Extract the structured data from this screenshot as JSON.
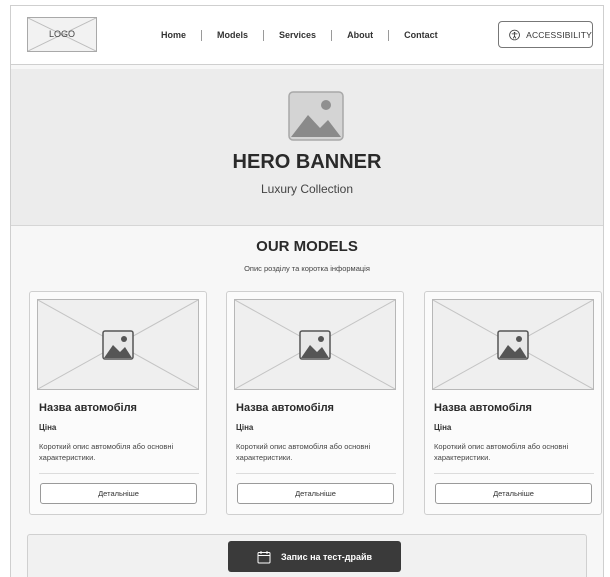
{
  "header": {
    "logo_text": "LOGO",
    "nav": [
      "Home",
      "Models",
      "Services",
      "About",
      "Contact"
    ],
    "accessibility_label": "ACCESSIBILITY"
  },
  "hero": {
    "title": "HERO BANNER",
    "subtitle": "Luxury Collection"
  },
  "models": {
    "title": "OUR MODELS",
    "description": "Опис розділу та коротка інформація",
    "cards": [
      {
        "name": "Назва автомобіля",
        "price": "Ціна",
        "description": "Короткий опис автомобіля або основні характеристики.",
        "button_label": "Детальніше"
      },
      {
        "name": "Назва автомобіля",
        "price": "Ціна",
        "description": "Короткий опис автомобіля або основні характеристики.",
        "button_label": "Детальніше"
      },
      {
        "name": "Назва автомобіля",
        "price": "Ціна",
        "description": "Короткий опис автомобіля або основні характеристики.",
        "button_label": "Детальніше"
      }
    ]
  },
  "cta": {
    "test_drive_label": "Запис на тест-драйв"
  },
  "icons": {
    "accessibility": "accessibility-icon",
    "image_placeholder": "image-placeholder-icon",
    "calendar": "calendar-icon"
  },
  "colors": {
    "cta_background": "#3a3a3a",
    "hero_background": "#ececec"
  }
}
